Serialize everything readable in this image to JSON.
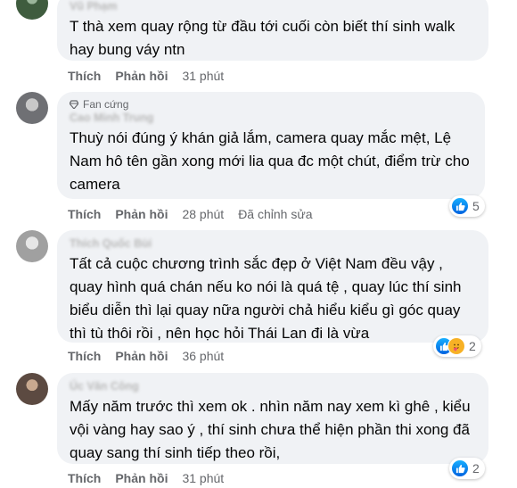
{
  "comments": [
    {
      "author": "Vũ Phạm",
      "badge": "",
      "text": "T thà xem quay rộng từ đầu tới cuối còn biết thí sinh walk hay bung váy ntn",
      "like": "Thích",
      "reply": "Phản hồi",
      "time": "31 phút",
      "edited": "",
      "reaction_count": "",
      "reactions": []
    },
    {
      "author": "Cao Minh Trung",
      "badge": "Fan cứng",
      "text": "Thuỳ nói đúng ý khán giả lắm, camera quay mắc mệt, Lệ Nam hô tên gần xong mới lia qua đc một chút, điểm trừ cho camera",
      "like": "Thích",
      "reply": "Phản hồi",
      "time": "28 phút",
      "edited": "Đã chỉnh sửa",
      "reaction_count": "5",
      "reactions": [
        "like-icon"
      ]
    },
    {
      "author": "Thích Quốc Bùi",
      "badge": "",
      "text": "Tất cả cuộc chương trình sắc đẹp ở Việt Nam đều vậy , quay hình quá chán nếu ko nói là quá tệ , quay lúc thí sinh biểu diễn thì lại quay nữa người chả hiểu kiểu gì góc quay thì tù thôi rồi , nên học hỏi Thái Lan đi là vừa",
      "like": "Thích",
      "reply": "Phản hồi",
      "time": "36 phút",
      "edited": "",
      "reaction_count": "2",
      "reactions": [
        "like-icon",
        "care-icon"
      ]
    },
    {
      "author": "Úc Văn Công",
      "badge": "",
      "text": "Mấy năm trước thì xem ok . nhìn năm nay xem kì ghê , kiểu vội vàng hay sao ý , thí sinh chưa thể hiện phần thi xong đã quay sang thí sinh tiếp theo rồi,",
      "like": "Thích",
      "reply": "Phản hồi",
      "time": "31 phút",
      "edited": "",
      "reaction_count": "2",
      "reactions": [
        "like-icon"
      ]
    }
  ],
  "colors": {
    "bubble": "#f0f2f5",
    "secondary_text": "#65676b",
    "like_blue": "#0062df"
  }
}
